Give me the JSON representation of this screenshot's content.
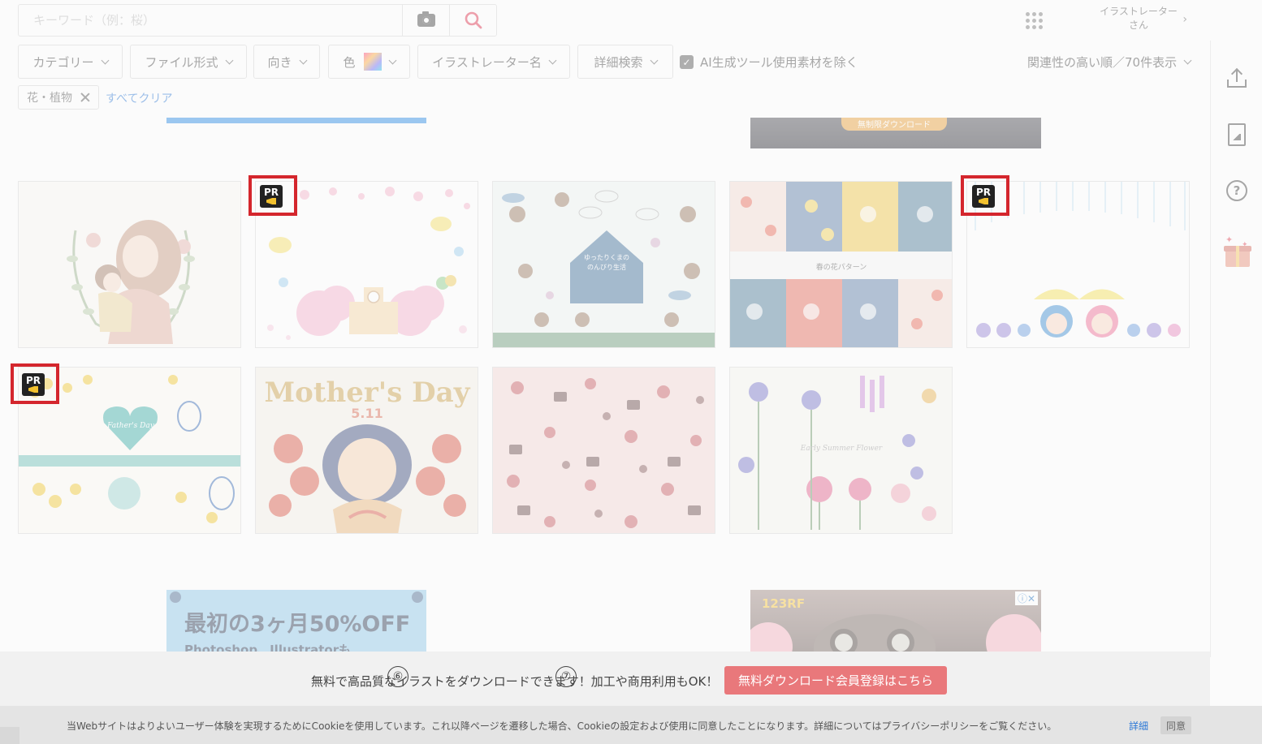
{
  "search": {
    "placeholder": "キーワード（例：桜）"
  },
  "header": {
    "illustrator_link": "イラストレーター\nさん"
  },
  "filters": {
    "category": "カテゴリー",
    "file_format": "ファイル形式",
    "orientation": "向き",
    "color": "色",
    "illustrator_name": "イラストレーター名",
    "advanced": "詳細検索",
    "exclude_ai": "AI生成ツール使用素材を除く",
    "sort": "関連性の高い順／70件表示"
  },
  "active_tags": [
    {
      "label": "花・植物"
    }
  ],
  "clear_all": "すべてクリア",
  "pr_badge": "PR",
  "grid": {
    "cards": [
      {
        "id": "mother-child-wreath",
        "pr": false
      },
      {
        "id": "spring-school-frame",
        "pr": true
      },
      {
        "id": "rainy-bears",
        "pr": false,
        "title": "ゆったりくまの\nのんびり生活"
      },
      {
        "id": "spring-flower-pattern",
        "pr": false,
        "label": "春の花パターン"
      },
      {
        "id": "rain-kids-frame",
        "pr": true
      },
      {
        "id": "fathers-day-set",
        "pr": true,
        "label": "Father's Day"
      },
      {
        "id": "mothers-day-5-11",
        "pr": false,
        "headline": "Mother's Day",
        "date": "5.11"
      },
      {
        "id": "valentine-pattern",
        "pr": false
      },
      {
        "id": "early-summer-flowers",
        "pr": false,
        "label": "Early Summer Flower"
      }
    ]
  },
  "ads": {
    "left_headline": "最初の3ヶ月50%OFF",
    "left_sub": "Photoshop、Illustratorも",
    "right_logo": "123RF",
    "top_right_pill": "無制限ダウンロード"
  },
  "signup": {
    "message": "無料で高品質なイラストをダウンロードできます！加工や商用利用もOK！",
    "button": "無料ダウンロード会員登録はこちら",
    "markers": [
      "⑥",
      "⑦"
    ]
  },
  "cookie": {
    "text": "当Webサイトはよりよいユーザー体験を実現するためにCookieを使用しています。これ以降ページを遷移した場合、Cookieの設定および使用に同意したことになります。詳細についてはプライバシーポリシーをご覧ください。",
    "details": "詳細",
    "agree": "同意"
  },
  "colors": {
    "pr_frame": "#d4262d",
    "accent_blue": "#2c78d6",
    "search_red": "#e0334e",
    "signup_button": "#e9787b"
  }
}
